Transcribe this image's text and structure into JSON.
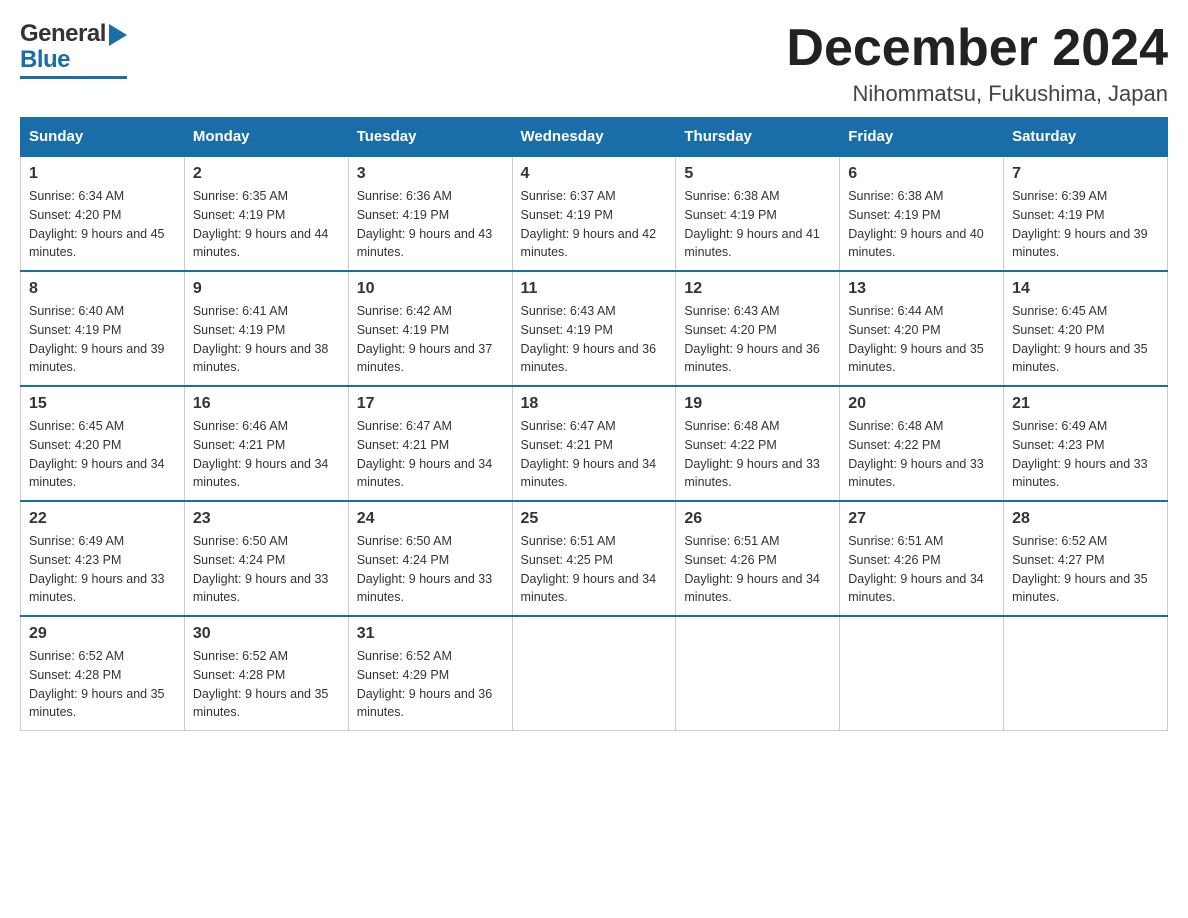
{
  "header": {
    "logo_general": "General",
    "logo_blue": "Blue",
    "month_title": "December 2024",
    "location": "Nihommatsu, Fukushima, Japan"
  },
  "weekdays": [
    "Sunday",
    "Monday",
    "Tuesday",
    "Wednesday",
    "Thursday",
    "Friday",
    "Saturday"
  ],
  "weeks": [
    [
      {
        "day": "1",
        "sunrise": "6:34 AM",
        "sunset": "4:20 PM",
        "daylight": "9 hours and 45 minutes."
      },
      {
        "day": "2",
        "sunrise": "6:35 AM",
        "sunset": "4:19 PM",
        "daylight": "9 hours and 44 minutes."
      },
      {
        "day": "3",
        "sunrise": "6:36 AM",
        "sunset": "4:19 PM",
        "daylight": "9 hours and 43 minutes."
      },
      {
        "day": "4",
        "sunrise": "6:37 AM",
        "sunset": "4:19 PM",
        "daylight": "9 hours and 42 minutes."
      },
      {
        "day": "5",
        "sunrise": "6:38 AM",
        "sunset": "4:19 PM",
        "daylight": "9 hours and 41 minutes."
      },
      {
        "day": "6",
        "sunrise": "6:38 AM",
        "sunset": "4:19 PM",
        "daylight": "9 hours and 40 minutes."
      },
      {
        "day": "7",
        "sunrise": "6:39 AM",
        "sunset": "4:19 PM",
        "daylight": "9 hours and 39 minutes."
      }
    ],
    [
      {
        "day": "8",
        "sunrise": "6:40 AM",
        "sunset": "4:19 PM",
        "daylight": "9 hours and 39 minutes."
      },
      {
        "day": "9",
        "sunrise": "6:41 AM",
        "sunset": "4:19 PM",
        "daylight": "9 hours and 38 minutes."
      },
      {
        "day": "10",
        "sunrise": "6:42 AM",
        "sunset": "4:19 PM",
        "daylight": "9 hours and 37 minutes."
      },
      {
        "day": "11",
        "sunrise": "6:43 AM",
        "sunset": "4:19 PM",
        "daylight": "9 hours and 36 minutes."
      },
      {
        "day": "12",
        "sunrise": "6:43 AM",
        "sunset": "4:20 PM",
        "daylight": "9 hours and 36 minutes."
      },
      {
        "day": "13",
        "sunrise": "6:44 AM",
        "sunset": "4:20 PM",
        "daylight": "9 hours and 35 minutes."
      },
      {
        "day": "14",
        "sunrise": "6:45 AM",
        "sunset": "4:20 PM",
        "daylight": "9 hours and 35 minutes."
      }
    ],
    [
      {
        "day": "15",
        "sunrise": "6:45 AM",
        "sunset": "4:20 PM",
        "daylight": "9 hours and 34 minutes."
      },
      {
        "day": "16",
        "sunrise": "6:46 AM",
        "sunset": "4:21 PM",
        "daylight": "9 hours and 34 minutes."
      },
      {
        "day": "17",
        "sunrise": "6:47 AM",
        "sunset": "4:21 PM",
        "daylight": "9 hours and 34 minutes."
      },
      {
        "day": "18",
        "sunrise": "6:47 AM",
        "sunset": "4:21 PM",
        "daylight": "9 hours and 34 minutes."
      },
      {
        "day": "19",
        "sunrise": "6:48 AM",
        "sunset": "4:22 PM",
        "daylight": "9 hours and 33 minutes."
      },
      {
        "day": "20",
        "sunrise": "6:48 AM",
        "sunset": "4:22 PM",
        "daylight": "9 hours and 33 minutes."
      },
      {
        "day": "21",
        "sunrise": "6:49 AM",
        "sunset": "4:23 PM",
        "daylight": "9 hours and 33 minutes."
      }
    ],
    [
      {
        "day": "22",
        "sunrise": "6:49 AM",
        "sunset": "4:23 PM",
        "daylight": "9 hours and 33 minutes."
      },
      {
        "day": "23",
        "sunrise": "6:50 AM",
        "sunset": "4:24 PM",
        "daylight": "9 hours and 33 minutes."
      },
      {
        "day": "24",
        "sunrise": "6:50 AM",
        "sunset": "4:24 PM",
        "daylight": "9 hours and 33 minutes."
      },
      {
        "day": "25",
        "sunrise": "6:51 AM",
        "sunset": "4:25 PM",
        "daylight": "9 hours and 34 minutes."
      },
      {
        "day": "26",
        "sunrise": "6:51 AM",
        "sunset": "4:26 PM",
        "daylight": "9 hours and 34 minutes."
      },
      {
        "day": "27",
        "sunrise": "6:51 AM",
        "sunset": "4:26 PM",
        "daylight": "9 hours and 34 minutes."
      },
      {
        "day": "28",
        "sunrise": "6:52 AM",
        "sunset": "4:27 PM",
        "daylight": "9 hours and 35 minutes."
      }
    ],
    [
      {
        "day": "29",
        "sunrise": "6:52 AM",
        "sunset": "4:28 PM",
        "daylight": "9 hours and 35 minutes."
      },
      {
        "day": "30",
        "sunrise": "6:52 AM",
        "sunset": "4:28 PM",
        "daylight": "9 hours and 35 minutes."
      },
      {
        "day": "31",
        "sunrise": "6:52 AM",
        "sunset": "4:29 PM",
        "daylight": "9 hours and 36 minutes."
      },
      null,
      null,
      null,
      null
    ]
  ]
}
